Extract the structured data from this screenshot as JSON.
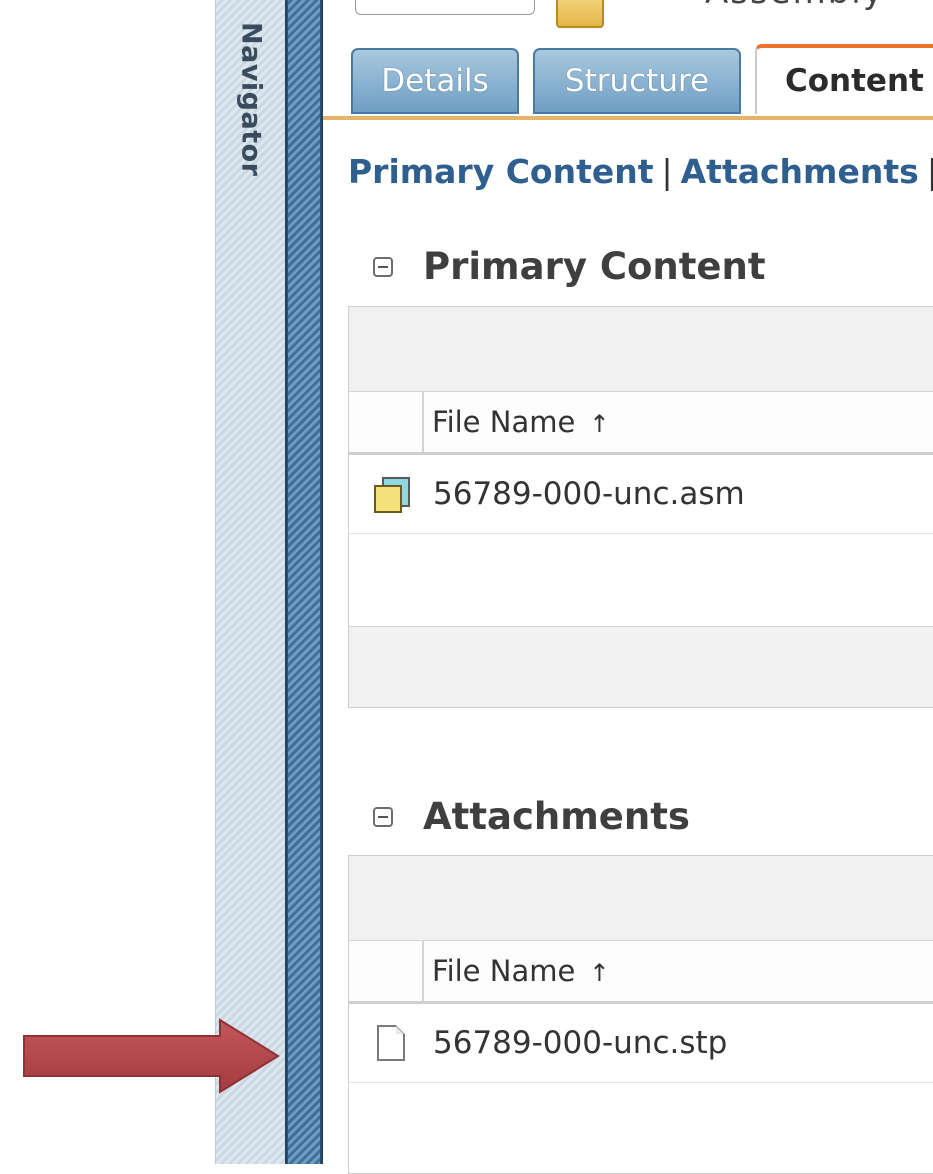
{
  "navigator": {
    "label": "Navigator"
  },
  "header": {
    "title_partial": "Assembly"
  },
  "tabs": [
    {
      "label": "Details",
      "active": false
    },
    {
      "label": "Structure",
      "active": false
    },
    {
      "label": "Content",
      "active": true
    }
  ],
  "subnav": {
    "links": [
      "Primary Content",
      "Attachments"
    ],
    "separator": "|"
  },
  "primary_content": {
    "title": "Primary Content",
    "column_header": "File Name",
    "sort_indicator": "↑",
    "rows": [
      {
        "icon": "assembly-file-icon",
        "file_name": "56789-000-unc.asm"
      }
    ]
  },
  "attachments": {
    "title": "Attachments",
    "column_header": "File Name",
    "sort_indicator": "↑",
    "rows": [
      {
        "icon": "document-file-icon",
        "file_name": "56789-000-unc.stp"
      }
    ]
  },
  "annotation": {
    "icon": "red-arrow-pointer",
    "color": "#b8474b"
  },
  "colors": {
    "tab_active_accent": "#e8742a",
    "link": "#2e5f8f",
    "tab_inactive": "#6f9fc4"
  }
}
